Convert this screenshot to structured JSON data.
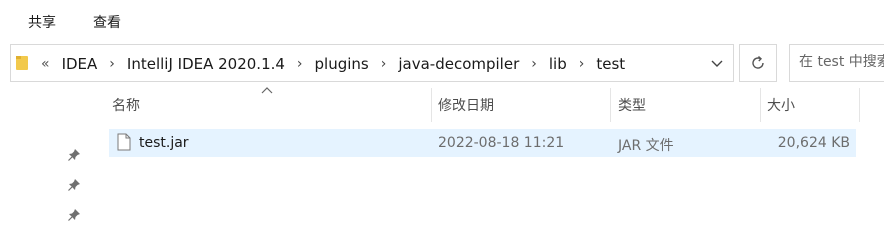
{
  "ribbon": {
    "tabs": [
      "共享",
      "查看"
    ]
  },
  "address": {
    "overflow_label": "«",
    "crumbs": [
      "IDEA",
      "IntelliJ IDEA 2020.1.4",
      "plugins",
      "java-decompiler",
      "lib",
      "test"
    ],
    "separator": "›"
  },
  "search": {
    "placeholder": "在 test 中搜索"
  },
  "columns": {
    "name": "名称",
    "modified": "修改日期",
    "type": "类型",
    "size": "大小"
  },
  "files": [
    {
      "name": "test.jar",
      "modified": "2022-08-18 11:21",
      "type": "JAR 文件",
      "size": "20,624 KB"
    }
  ],
  "icons": {
    "folder": "folder-icon",
    "refresh": "refresh-icon",
    "dropdown": "chevron-down-icon",
    "file": "file-icon",
    "pin": "pin-icon",
    "sort": "sort-ascending-icon"
  },
  "colors": {
    "selection": "#e5f3ff",
    "folder": "#f2c94c",
    "border": "#d9d9d9"
  }
}
